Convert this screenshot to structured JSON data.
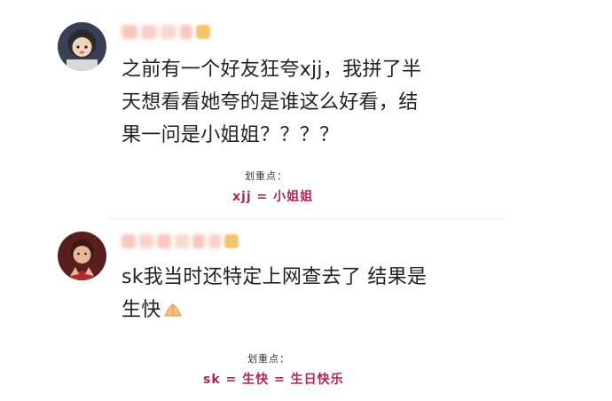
{
  "comments": [
    {
      "avatar": "avatar-girl-curly-hair",
      "text": "之前有一个好友狂夸xjj，我拼了半\n天想看看她夸的是谁这么好看，结\n果一问是小姐姐？？？？",
      "note_title": "划重点：",
      "note_answer": "xjj = 小姐姐"
    },
    {
      "avatar": "avatar-red-outfit",
      "text": "sk我当时还特定上网查去了 结果是\n生快",
      "emoji": "hands-praying-icon",
      "note_title": "划重点：",
      "note_answer": "sk = 生快 = 生日快乐"
    }
  ],
  "colors": {
    "accent": "#b0245a",
    "text": "#222222",
    "separator": "#eeeeee"
  }
}
